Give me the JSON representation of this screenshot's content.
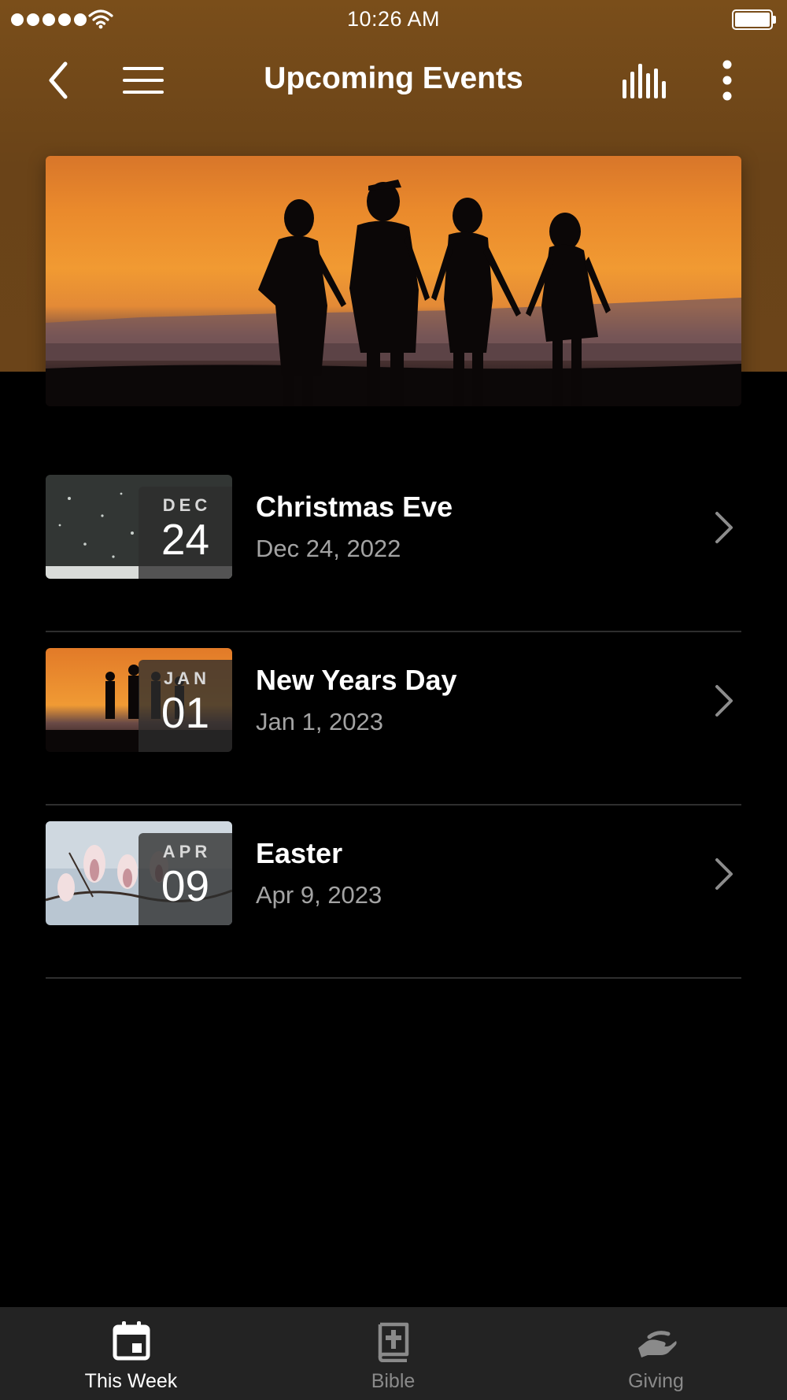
{
  "status_bar": {
    "time": "10:26 AM"
  },
  "nav": {
    "title": "Upcoming Events",
    "back_icon": "chevron-left-icon",
    "menu_icon": "hamburger-menu-icon",
    "stats_icon": "bar-chart-icon",
    "more_icon": "more-vertical-icon"
  },
  "colors": {
    "header_brown": "#6b4419",
    "background": "#000000",
    "tabbar": "#232323",
    "secondary_text": "#a3a3a3"
  },
  "events": [
    {
      "title": "Christmas Eve",
      "date": "Dec 24, 2022",
      "month": "DEC",
      "day": "24"
    },
    {
      "title": "New Years Day",
      "date": "Jan 1, 2023",
      "month": "JAN",
      "day": "01"
    },
    {
      "title": "Easter",
      "date": "Apr 9, 2023",
      "month": "APR",
      "day": "09"
    }
  ],
  "tabs": [
    {
      "label": "This Week",
      "icon": "calendar-icon",
      "active": true
    },
    {
      "label": "Bible",
      "icon": "bible-icon",
      "active": false
    },
    {
      "label": "Giving",
      "icon": "giving-hand-icon",
      "active": false
    }
  ]
}
